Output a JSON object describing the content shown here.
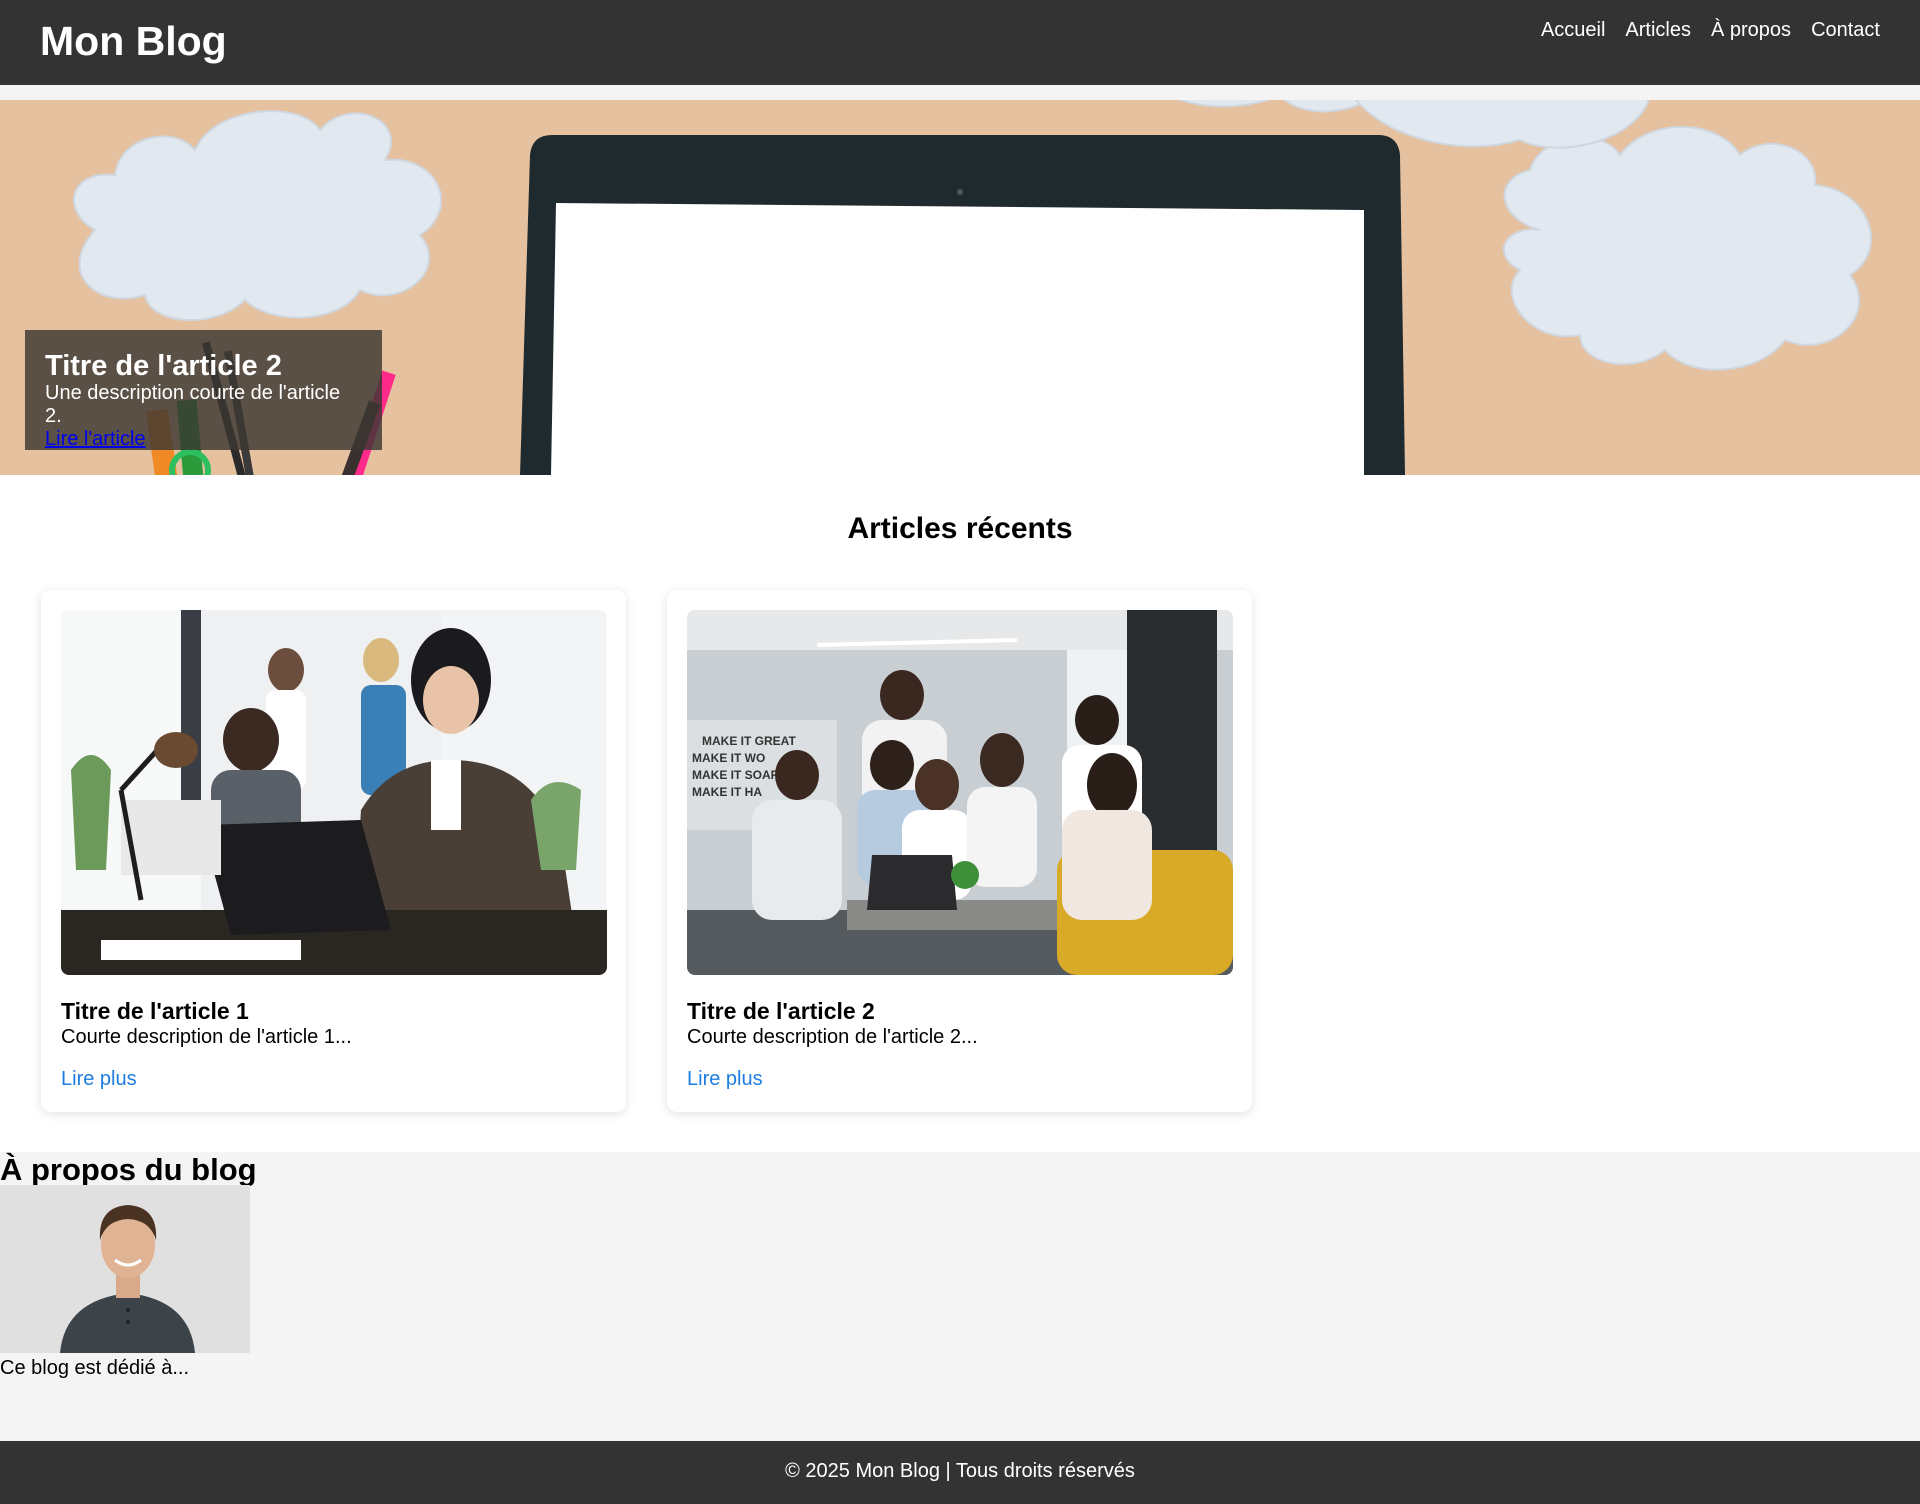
{
  "header": {
    "logo": "Mon Blog",
    "nav": [
      "Accueil",
      "Articles",
      "À propos",
      "Contact"
    ]
  },
  "hero": {
    "title": "Titre de l'article 2",
    "description": "Une description courte de l'article 2.",
    "link": "Lire l'article"
  },
  "recent": {
    "title": "Articles récents",
    "articles": [
      {
        "title": "Titre de l'article 1",
        "description": "Courte description de l'article 1...",
        "link": "Lire plus"
      },
      {
        "title": "Titre de l'article 2",
        "description": "Courte description de l'article 2...",
        "link": "Lire plus"
      }
    ]
  },
  "about": {
    "title": "À propos du blog",
    "text": "Ce blog est dédié à..."
  },
  "footer": {
    "text": "© 2025 Mon Blog | Tous droits réservés"
  },
  "colors": {
    "header_bg": "#333333",
    "link": "#1e7de0",
    "hero_bg": "#e6c19f",
    "about_bg": "#f4f4f4"
  }
}
